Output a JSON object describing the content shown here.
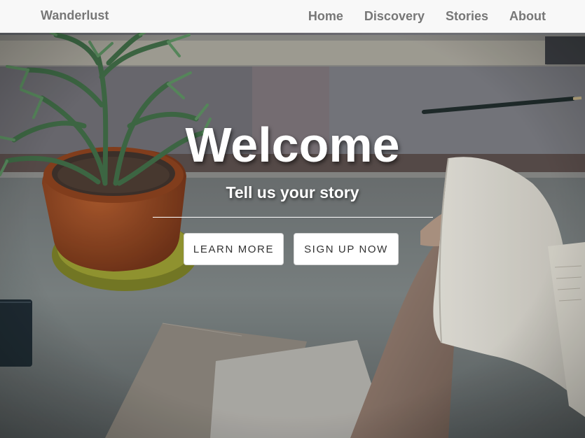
{
  "navbar": {
    "brand": "Wanderlust",
    "links": [
      {
        "label": "Home"
      },
      {
        "label": "Discovery"
      },
      {
        "label": "Stories"
      },
      {
        "label": "About"
      }
    ]
  },
  "hero": {
    "title": "Welcome",
    "subtitle": "Tell us your story",
    "buttons": [
      {
        "label": "LEARN MORE"
      },
      {
        "label": "SIGN UP NOW"
      }
    ],
    "background_scene": [
      "potted-plant",
      "open-book",
      "hand",
      "pencil",
      "paper-sheets",
      "notebook"
    ]
  },
  "colors": {
    "navbar_bg": "#f8f8f8",
    "nav_text": "#777777",
    "hero_text": "#ffffff",
    "button_bg": "#ffffff",
    "button_text": "#333333"
  }
}
